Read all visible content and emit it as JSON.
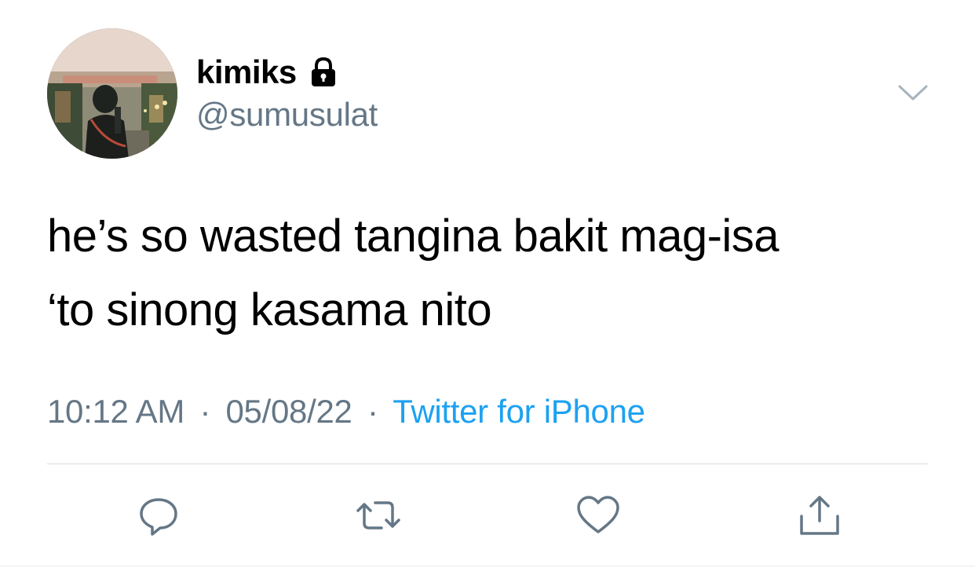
{
  "user": {
    "display_name": "kimiks",
    "handle": "@sumusulat",
    "protected": true
  },
  "tweet": {
    "text": "he’s so wasted tangina bakit mag-isa\n‘to sinong kasama nito",
    "time": "10:12 AM",
    "date": "05/08/22",
    "separator": "·",
    "source": "Twitter for iPhone"
  },
  "actions": [
    {
      "icon": "reply-icon"
    },
    {
      "icon": "retweet-icon"
    },
    {
      "icon": "like-icon"
    },
    {
      "icon": "share-icon"
    }
  ],
  "colors": {
    "text": "#000000",
    "muted": "#657786",
    "link": "#1da1f2",
    "divider": "#d7dde1"
  }
}
